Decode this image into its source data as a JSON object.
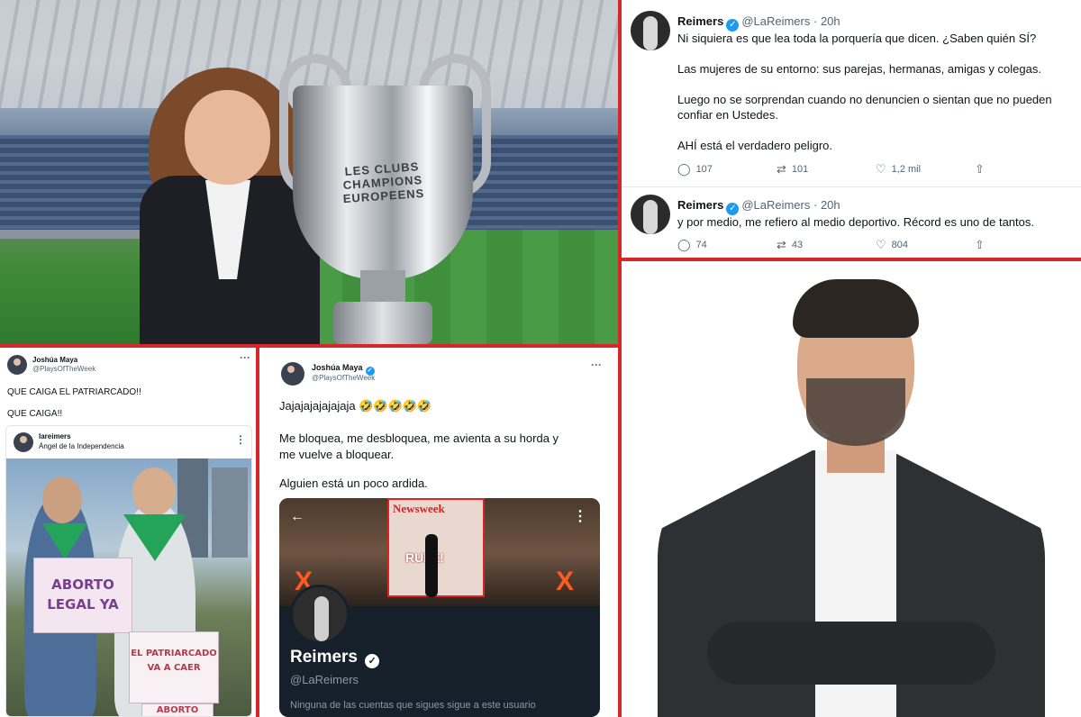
{
  "colors": {
    "divider": "#d9262b",
    "verified": "#1d9bf0",
    "embed_bg": "#15202b"
  },
  "stadium_photo": {
    "trophy_engraving": "LES CLUBS CHAMPIONS EUROPEENS"
  },
  "tweets": [
    {
      "name": "Reimers",
      "handle": "@LaReimers",
      "time": "· 20h",
      "text": "Ni siquiera es que lea toda la porquería que dicen. ¿Saben quién SÍ?\n\nLas mujeres de su entorno: sus parejas, hermanas, amigas y colegas.\n\nLuego no se sorprendan cuando no denuncien o sientan que no pueden\nconfiar en Ustedes.\n\nAHÍ está el verdadero peligro.",
      "replies": "107",
      "retweets": "101",
      "likes": "1,2 mil"
    },
    {
      "name": "Reimers",
      "handle": "@LaReimers",
      "time": "· 20h",
      "text": "y por medio, me refiero al medio deportivo. Récord es uno de tantos.",
      "replies": "74",
      "retweets": "43",
      "likes": "804"
    }
  ],
  "protest_tweet": {
    "name": "Joshúa Maya",
    "handle": "@PlaysOfTheWeek",
    "line1": "QUE CAIGA EL PATRIARCADO!!",
    "line2": "QUE CAIGA!!",
    "quoted_user": "lareimers",
    "quoted_location": "Ángel de la Independencia",
    "sign1": "ABORTO\nLEGAL YA",
    "sign2": "EL PATRIARCADO\nVA A CAER",
    "sign3": "ABORTO"
  },
  "joshua_tweet": {
    "name": "Joshúa Maya",
    "handle": "@PlaysOfTheWeek",
    "line1": "Jajajajajajajaja 🤣🤣🤣🤣🤣",
    "line2": "Me bloquea, me desbloquea, me avienta a su horda y",
    "line3": "me vuelve a bloquear.",
    "line4": "Alguien está un poco ardida.",
    "embed": {
      "magazine": "Newsweek",
      "magazine_cover_text": "RULE!",
      "profile_name": "Reimers",
      "profile_handle": "@LaReimers",
      "note": "Ninguna de las cuentas que sigues sigue a este usuario"
    }
  },
  "icons": [
    "reply-icon",
    "retweet-icon",
    "like-icon",
    "share-icon",
    "verified-icon",
    "more-icon",
    "back-arrow-icon"
  ]
}
